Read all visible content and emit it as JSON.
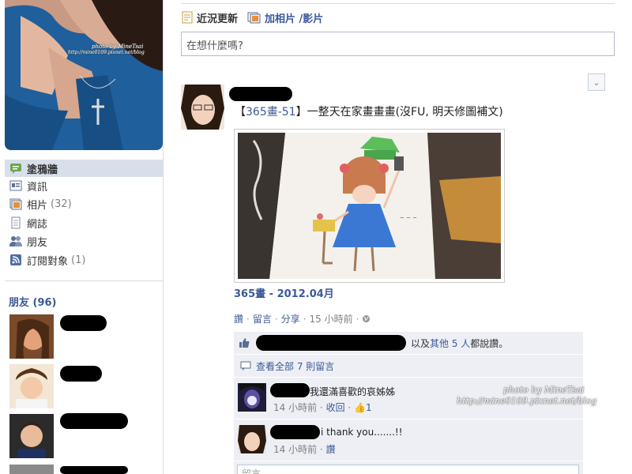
{
  "sidebar": {
    "nav": [
      {
        "label": "塗鴉牆",
        "count": "",
        "icon": "wall-icon",
        "active": true
      },
      {
        "label": "資訊",
        "count": "",
        "icon": "info-icon",
        "active": false
      },
      {
        "label": "相片",
        "count": "(32)",
        "icon": "photos-icon",
        "active": false
      },
      {
        "label": "網誌",
        "count": "",
        "icon": "notes-icon",
        "active": false
      },
      {
        "label": "朋友",
        "count": "",
        "icon": "friends-icon",
        "active": false
      },
      {
        "label": "訂閱對象",
        "count": "(1)",
        "icon": "subscriptions-icon",
        "active": false
      }
    ],
    "friends_title": "朋友 (96)"
  },
  "composer": {
    "tab_status": "近況更新",
    "tab_photo": "加相片 /影片",
    "placeholder": "在想什麼嗎?"
  },
  "post": {
    "text_prefix": "【",
    "text_tag": "365畫-51",
    "text_suffix": "】一整天在家畫畫畫(沒FU, 明天修圖補文)",
    "album_link": "365畫 - 2012.04月",
    "actions": {
      "like": "讚",
      "comment": "留言",
      "share": "分享",
      "time": "15 小時前"
    }
  },
  "feedback": {
    "likes_and": "以及",
    "likes_others": "其他 5 人",
    "likes_suffix": "都說讚。",
    "view_all": "查看全部 7 則留言",
    "comments": [
      {
        "text": "我還滿喜歡的哀姊姊",
        "time": "14 小時前",
        "action1": "收回",
        "likes": "1"
      },
      {
        "text": "i thank you.......!!",
        "time": "14 小時前",
        "action1": "讚",
        "likes": ""
      }
    ],
    "input_placeholder": "留言……"
  },
  "watermarks": {
    "top": "photo by MineTsai",
    "top_url": "http://mine0109.pixnet.net/blog",
    "bottom": "photo by MineTsai",
    "bottom_url": "http://mine0109.pixnet.net/blog"
  },
  "colors": {
    "link": "#3b5998",
    "feedback_bg": "#edeff4",
    "active_nav": "#d8dfea"
  }
}
